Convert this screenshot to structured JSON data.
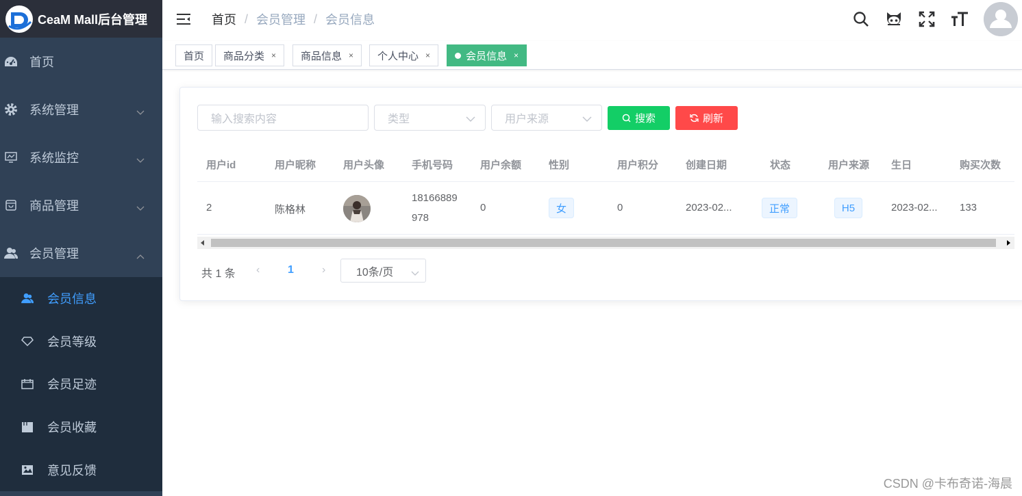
{
  "app": {
    "title": "CeaM Mall后台管理"
  },
  "sidebar": {
    "items": [
      {
        "label": "首页",
        "icon": "dashboard-icon"
      },
      {
        "label": "系统管理",
        "icon": "gear-icon"
      },
      {
        "label": "系统监控",
        "icon": "monitor-icon"
      },
      {
        "label": "商品管理",
        "icon": "shopping-icon"
      },
      {
        "label": "会员管理",
        "icon": "user-group-icon"
      }
    ],
    "submenu": [
      {
        "label": "会员信息",
        "icon": "user-group-icon",
        "active": true
      },
      {
        "label": "会员等级",
        "icon": "diamond-icon"
      },
      {
        "label": "会员足迹",
        "icon": "calendar-icon"
      },
      {
        "label": "会员收藏",
        "icon": "folder-icon"
      },
      {
        "label": "意见反馈",
        "icon": "image-icon"
      }
    ]
  },
  "breadcrumb": [
    "首页",
    "会员管理",
    "会员信息"
  ],
  "tags": [
    {
      "label": "首页"
    },
    {
      "label": "商品分类",
      "close": "×"
    },
    {
      "label": "商品信息",
      "close": "×"
    },
    {
      "label": "个人中心",
      "close": "×"
    },
    {
      "label": "会员信息",
      "close": "×",
      "active": true
    }
  ],
  "filter": {
    "search_placeholder": "输入搜索内容",
    "type_placeholder": "类型",
    "source_placeholder": "用户来源",
    "search_button": "搜索",
    "refresh_button": "刷新"
  },
  "table": {
    "columns": [
      "用户id",
      "用户昵称",
      "用户头像",
      "手机号码",
      "用户余额",
      "性别",
      "用户积分",
      "创建日期",
      "状态",
      "用户来源",
      "生日",
      "购买次数"
    ],
    "rows": [
      {
        "id": "2",
        "nickname": "陈格林",
        "phone_line1": "18166889",
        "phone_line2": "978",
        "balance": "0",
        "gender": "女",
        "points": "0",
        "created": "2023-02...",
        "status": "正常",
        "source": "H5",
        "birthday": "2023-02...",
        "purchases": "133"
      }
    ]
  },
  "pagination": {
    "total": "共 1 条",
    "prev": "‹",
    "page": "1",
    "next": "›",
    "page_size": "10条/页"
  },
  "watermark": "CSDN @卡布奇诺-海晨",
  "colors": {
    "sidebar_bg": "#304156",
    "submenu_bg": "#1f2d3d",
    "active_tag": "#42b983",
    "search_btn": "#13ce66",
    "refresh_btn": "#ff4949",
    "primary": "#409eff"
  }
}
